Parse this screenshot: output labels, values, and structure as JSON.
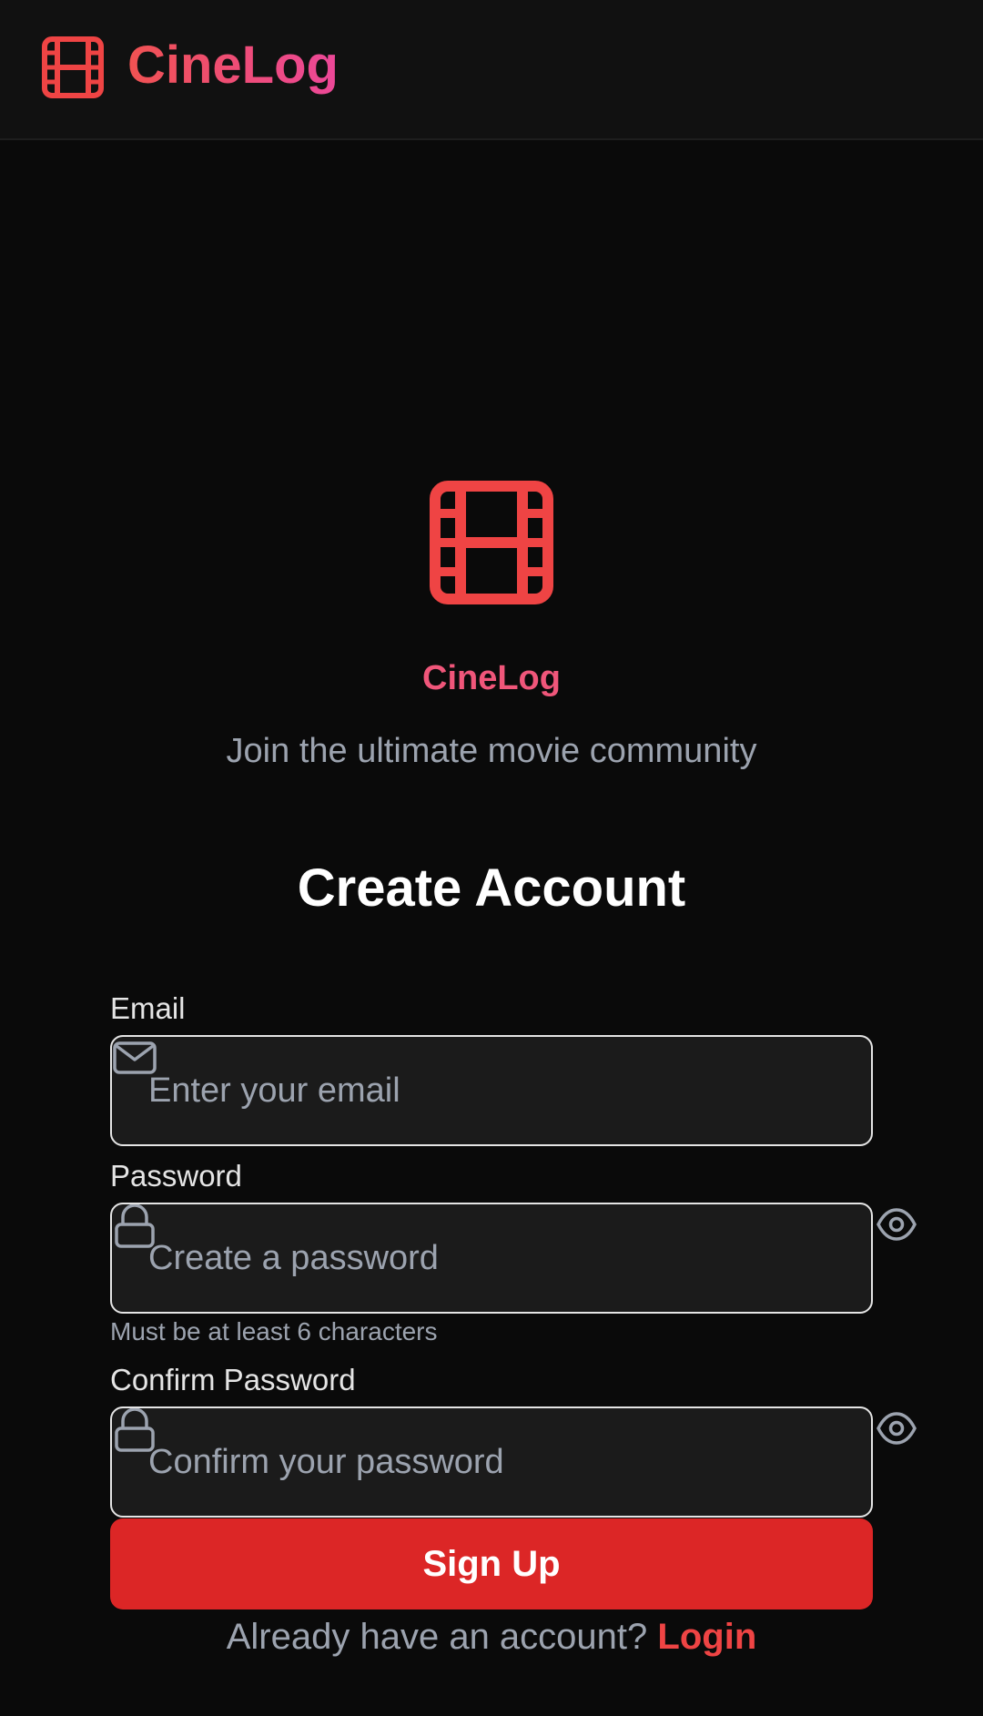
{
  "header": {
    "logo_icon": "film-icon",
    "title": "CineLog"
  },
  "hero": {
    "logo_icon": "film-icon",
    "title": "CineLog",
    "subtitle": "Join the ultimate movie community"
  },
  "form": {
    "title": "Create Account",
    "email": {
      "label": "Email",
      "icon": "mail-icon",
      "placeholder": "Enter your email"
    },
    "password": {
      "label": "Password",
      "icon": "lock-icon",
      "placeholder": "Create a password",
      "helper": "Must be at least 6 characters",
      "toggle_icon": "eye-icon"
    },
    "confirm_password": {
      "label": "Confirm Password",
      "icon": "lock-icon",
      "placeholder": "Confirm your password",
      "toggle_icon": "eye-icon"
    },
    "submit_label": "Sign Up",
    "login_prompt": "Already have an account?",
    "login_link": "Login"
  },
  "colors": {
    "background": "#0a0a0a",
    "header_bg": "#111111",
    "accent_red": "#ef4444",
    "accent_pink": "#ec4899",
    "button_bg": "#dc2626",
    "input_bg": "#1b1b1b",
    "muted_text": "#9ca3af"
  }
}
